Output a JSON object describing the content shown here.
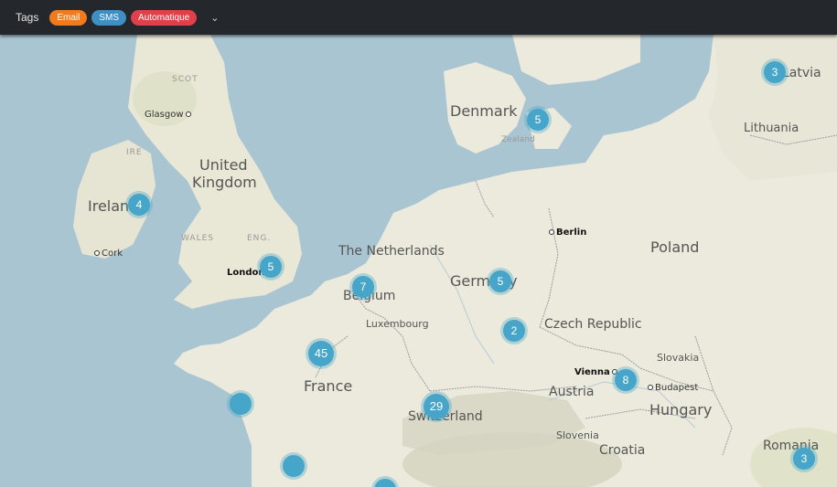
{
  "toolbar": {
    "label": "Tags",
    "tags": [
      {
        "label": "Email",
        "color": "#f07a1c"
      },
      {
        "label": "SMS",
        "color": "#3e8fc4"
      },
      {
        "label": "Automatique",
        "color": "#e0404a"
      }
    ],
    "dropdown_icon": "chevron-down-icon"
  },
  "map": {
    "labels": {
      "denmark": "Denmark",
      "zealand": "Zealand",
      "latvia": "Latvia",
      "lithuania": "Lithuania",
      "scot": "SCOT",
      "glasgow": "Glasgow",
      "ire": "IRE",
      "united_kingdom_1": "United",
      "united_kingdom_2": "Kingdom",
      "ireland": "Ireland",
      "wales": "WALES",
      "eng": "ENG.",
      "cork": "Cork",
      "london": "London",
      "netherlands": "The Netherlands",
      "berlin": "Berlin",
      "poland": "Poland",
      "germany": "Germany",
      "belgium": "Belgium",
      "luxembourg": "Luxembourg",
      "czech": "Czech Republic",
      "slovakia": "Slovakia",
      "vienna": "Vienna",
      "budapest": "Budapest",
      "austria": "Austria",
      "hungary": "Hungary",
      "france": "France",
      "switzerland": "Switzerland",
      "slovenia": "Slovenia",
      "croatia": "Croatia",
      "romania": "Romania"
    },
    "clusters": [
      {
        "id": "latvia",
        "count": "3"
      },
      {
        "id": "denmark",
        "count": "5"
      },
      {
        "id": "ireland",
        "count": "4"
      },
      {
        "id": "london",
        "count": "5"
      },
      {
        "id": "belgium",
        "count": "7"
      },
      {
        "id": "germany",
        "count": "5"
      },
      {
        "id": "czech",
        "count": "2"
      },
      {
        "id": "france",
        "count": "45"
      },
      {
        "id": "vienna",
        "count": "8"
      },
      {
        "id": "switzerland",
        "count": "29"
      },
      {
        "id": "romania",
        "count": "3"
      },
      {
        "id": "west-france",
        "count": ""
      },
      {
        "id": "southwest-france",
        "count": ""
      },
      {
        "id": "south-edge",
        "count": ""
      }
    ]
  }
}
